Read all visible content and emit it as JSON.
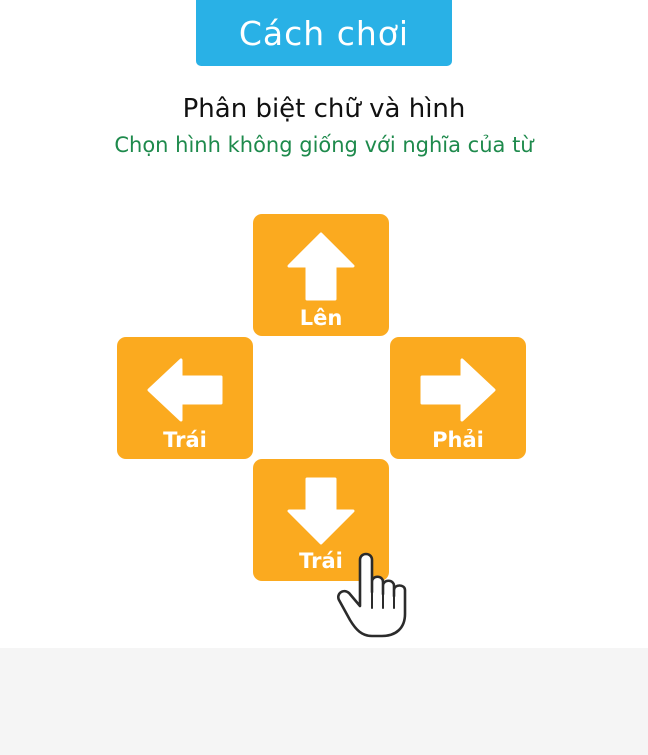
{
  "header": {
    "title": "Cách chơi"
  },
  "instructions": {
    "title": "Phân biệt chữ và hình",
    "subtitle": "Chọn hình không giống với nghĩa của từ"
  },
  "tiles": [
    {
      "id": "up",
      "label": "Lên",
      "arrow_icon": "arrow-up-icon"
    },
    {
      "id": "left",
      "label": "Trái",
      "arrow_icon": "arrow-left-icon"
    },
    {
      "id": "right",
      "label": "Phải",
      "arrow_icon": "arrow-right-icon"
    },
    {
      "id": "down",
      "label": "Trái",
      "arrow_icon": "arrow-down-icon"
    }
  ],
  "pointer": {
    "icon": "pointing-hand-icon"
  },
  "colors": {
    "header_bg": "#29b1e6",
    "tile_bg": "#fbaa1f",
    "subtitle": "#1e8a4c",
    "title": "#111111"
  }
}
